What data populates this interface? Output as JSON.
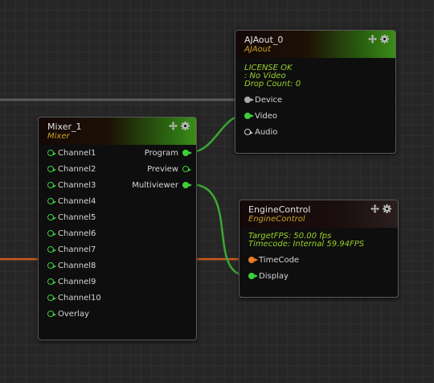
{
  "colors": {
    "link_green": "#3aa832",
    "link_orange": "#c85a1e",
    "link_grey": "#5c5c5c",
    "port_green": "#3fcf3a",
    "port_orange": "#ee7a2a",
    "type_label": "#c9a227",
    "info_text": "#9ad128"
  },
  "nodes": {
    "ajaout": {
      "title": "AJAout_0",
      "type": "AJAout",
      "header_icons": [
        "move-icon",
        "gear-icon"
      ],
      "info": [
        "LICENSE OK",
        ": No Video",
        "Drop Count: 0"
      ],
      "inputs": [
        {
          "label": "Device",
          "state": "grey-filled"
        },
        {
          "label": "Video",
          "state": "green-filled"
        },
        {
          "label": "Audio",
          "state": "grey-hollow"
        }
      ]
    },
    "mixer": {
      "title": "Mixer_1",
      "type": "Mixer",
      "header_icons": [
        "move-icon",
        "gear-icon"
      ],
      "inputs": [
        {
          "label": "Channel1"
        },
        {
          "label": "Channel2"
        },
        {
          "label": "Channel3"
        },
        {
          "label": "Channel4"
        },
        {
          "label": "Channel5"
        },
        {
          "label": "Channel6"
        },
        {
          "label": "Channel7"
        },
        {
          "label": "Channel8"
        },
        {
          "label": "Channel9"
        },
        {
          "label": "Channel10"
        },
        {
          "label": "Overlay"
        }
      ],
      "outputs": [
        {
          "label": "Program",
          "state": "green-filled"
        },
        {
          "label": "Preview",
          "state": "green-hollow"
        },
        {
          "label": "Multiviewer",
          "state": "green-filled"
        }
      ]
    },
    "engine": {
      "title": "EngineControl",
      "type": "EngineControl",
      "header_icons": [
        "move-icon",
        "gear-icon"
      ],
      "info": [
        "TargetFPS: 50.00 fps",
        "Timecode: Internal 59.94FPS"
      ],
      "inputs": [
        {
          "label": "TimeCode",
          "state": "orange-filled"
        },
        {
          "label": "Display",
          "state": "green-filled"
        }
      ]
    }
  }
}
